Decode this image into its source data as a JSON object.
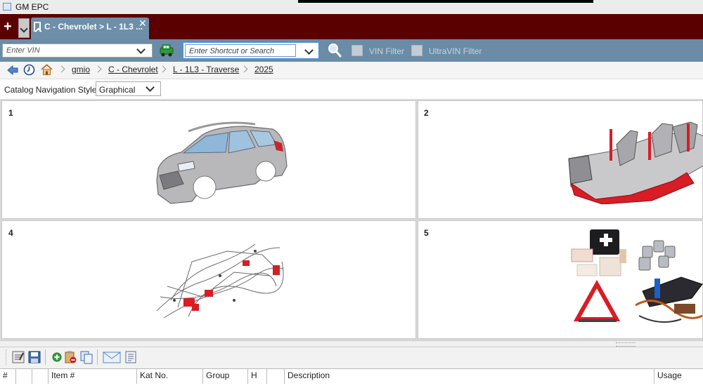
{
  "window": {
    "title": "GM EPC"
  },
  "tab": {
    "label": "C - Chevrolet > L - 1L3 ...",
    "close": "✕"
  },
  "toolbar": {
    "plus": "+",
    "vin_placeholder": "Enter VIN",
    "search_placeholder": "Enter Shortcut or Search",
    "vin_filter_label": "VIN Filter",
    "ultravin_filter_label": "UltraVIN Filter"
  },
  "breadcrumb": [
    "gmio",
    "C - Chevrolet",
    "L - 1L3 - Traverse",
    "2025"
  ],
  "nav_style": {
    "label": "Catalog Navigation Style:",
    "value": "Graphical"
  },
  "catalog_cells": [
    {
      "number": "1"
    },
    {
      "number": "2"
    },
    {
      "number": "4"
    },
    {
      "number": "5"
    }
  ],
  "table": {
    "columns": [
      "#",
      "",
      "",
      "Item #",
      "Kat No.",
      "Group",
      "H",
      "",
      "Description",
      "Usage"
    ]
  },
  "colors": {
    "tab_strip": "#5a0000",
    "toolbar": "#6b8ca6",
    "tab": "#6d8fa9",
    "accent_red": "#d81d25"
  }
}
